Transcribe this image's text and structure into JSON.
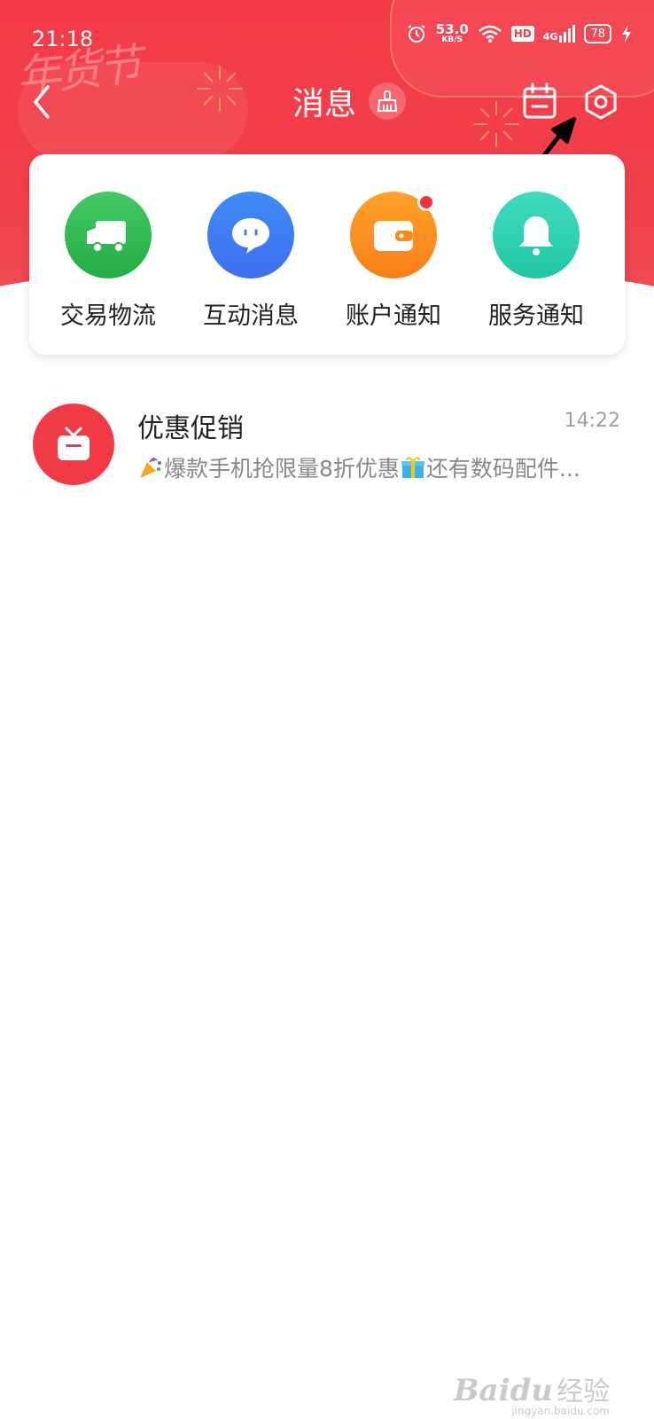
{
  "status_bar": {
    "time": "21:18",
    "net_speed": "53.0",
    "net_speed_unit": "KB/S",
    "hd_label": "HD",
    "network": "4G",
    "battery": "78"
  },
  "header": {
    "title": "消息",
    "festival_text": "年货节",
    "accent_color": "#f2404b"
  },
  "categories": [
    {
      "label": "交易物流",
      "icon": "truck-icon",
      "color": "#2fb84e",
      "badge": false
    },
    {
      "label": "互动消息",
      "icon": "chat-bubble-icon",
      "color": "#4178f0",
      "badge": false
    },
    {
      "label": "账户通知",
      "icon": "wallet-icon",
      "color": "#fb8a1c",
      "badge": true
    },
    {
      "label": "服务通知",
      "icon": "bell-icon",
      "color": "#2fd4b0",
      "badge": false
    }
  ],
  "messages": [
    {
      "title": "优惠促销",
      "time": "14:22",
      "preview_part1": "爆款手机抢限量8折优惠",
      "preview_part2": "还有数码配件...",
      "icon": "gift-icon"
    }
  ],
  "watermark": {
    "logo": "Baidu",
    "cn": "经验",
    "url": "jingyan.baidu.com"
  }
}
